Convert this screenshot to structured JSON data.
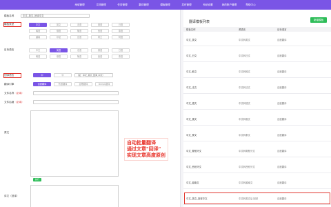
{
  "nav": {
    "items": [
      "地域管理",
      "文档管理",
      "任务管理",
      "翻译管理",
      "模板管理",
      "发布管理",
      "系统设置",
      "我的账户管理",
      "帮助中心"
    ]
  },
  "form": {
    "template_name": {
      "label": "模板名称",
      "value": "中文_英文_回译中文"
    },
    "mode": {
      "label": "模板类型",
      "options": [
        "中文",
        "英文",
        "法语",
        "德语",
        "日语",
        "韩语",
        "俄语",
        "葡语",
        "西语",
        "泰语",
        "越南",
        "印尼",
        "意语",
        "荷兰",
        "阿语"
      ],
      "selected": 0
    },
    "target": {
      "label": "目标语言",
      "options": [
        "中文",
        "英语",
        "法语",
        "德语",
        "日语",
        "韩语",
        "俄语",
        "葡语",
        "西语",
        "泰语"
      ],
      "selected": 1
    },
    "back": {
      "label": "回译语言",
      "value": "中",
      "mid": "中",
      "hint": "（如：中文_英文_回译_中文）"
    },
    "engine": {
      "label": "翻译引擎",
      "options": [
        "百度翻译",
        "有道翻译",
        "谷歌翻译",
        "DeepL翻译"
      ],
      "selected": 0
    },
    "file_a": {
      "label": "文件名称",
      "required": "（必填）"
    },
    "file_b": {
      "label": "文件后缀",
      "required": "（必填）"
    },
    "orig": {
      "label": "原文"
    },
    "trans": {
      "label": "译文（回译）"
    },
    "apply_label": "执行"
  },
  "annotation": [
    "自动批量翻译",
    "通过文章\"回译\"",
    "实现文章高度原创"
  ],
  "panel": {
    "title": "翻译模板列表",
    "add_button": "新增模板",
    "columns": [
      "模板名称",
      "源语言",
      "目标语言"
    ],
    "rows": [
      [
        "中文_英文",
        "中文转英文",
        "百度翻译"
      ],
      [
        "中文_日文",
        "中文转日文",
        "百度翻译"
      ],
      [
        "中文_韩文",
        "中文转韩文",
        "百度翻译"
      ],
      [
        "中文_法文",
        "中文转法文",
        "百度翻译"
      ],
      [
        "中文_德文",
        "中文转德文",
        "百度翻译"
      ],
      [
        "中文_俄文",
        "中文转俄文",
        "百度翻译"
      ],
      [
        "中文_泰文",
        "中文转泰文",
        "百度翻译"
      ],
      [
        "中文_葡萄牙文",
        "中文转葡萄牙文",
        "百度翻译"
      ],
      [
        "中文_西班牙文",
        "中文转西班牙文",
        "百度翻译"
      ],
      [
        "中文_越南文",
        "中文转越南文",
        "百度翻译"
      ],
      [
        "中文_英文_回译中文",
        "中文转英文后 回译",
        "百度翻译"
      ]
    ]
  }
}
